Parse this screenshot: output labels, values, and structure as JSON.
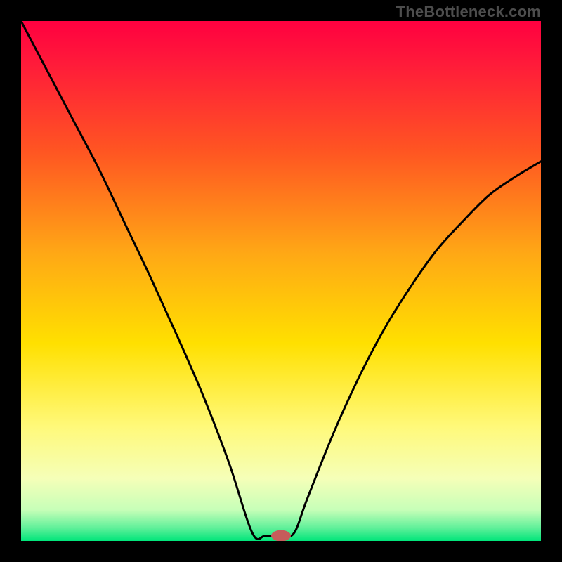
{
  "watermark": "TheBottleneck.com",
  "chart_data": {
    "type": "line",
    "title": "",
    "xlabel": "",
    "ylabel": "",
    "xlim": [
      0,
      1
    ],
    "ylim": [
      0,
      1
    ],
    "grid": false,
    "legend": false,
    "background_gradient": {
      "stops": [
        {
          "offset": 0.0,
          "color": "#ff0040"
        },
        {
          "offset": 0.08,
          "color": "#ff1a3a"
        },
        {
          "offset": 0.25,
          "color": "#ff5522"
        },
        {
          "offset": 0.45,
          "color": "#ffa915"
        },
        {
          "offset": 0.62,
          "color": "#ffe000"
        },
        {
          "offset": 0.78,
          "color": "#fff97a"
        },
        {
          "offset": 0.88,
          "color": "#f5ffb8"
        },
        {
          "offset": 0.94,
          "color": "#c7ffb8"
        },
        {
          "offset": 0.975,
          "color": "#60f09a"
        },
        {
          "offset": 1.0,
          "color": "#00e57a"
        }
      ]
    },
    "series": [
      {
        "name": "bottleneck-curve",
        "color": "#000000",
        "x": [
          0.0,
          0.05,
          0.1,
          0.15,
          0.2,
          0.25,
          0.3,
          0.35,
          0.4,
          0.445,
          0.47,
          0.5,
          0.525,
          0.55,
          0.6,
          0.65,
          0.7,
          0.75,
          0.8,
          0.85,
          0.9,
          0.95,
          1.0
        ],
        "y": [
          1.0,
          0.905,
          0.81,
          0.715,
          0.61,
          0.505,
          0.395,
          0.28,
          0.15,
          0.015,
          0.01,
          0.01,
          0.015,
          0.08,
          0.205,
          0.315,
          0.41,
          0.49,
          0.56,
          0.615,
          0.665,
          0.7,
          0.73
        ]
      }
    ],
    "marker": {
      "name": "optimum-point",
      "x": 0.5,
      "y": 0.01,
      "color": "#c65b5b",
      "rx": 14,
      "ry": 8
    }
  }
}
